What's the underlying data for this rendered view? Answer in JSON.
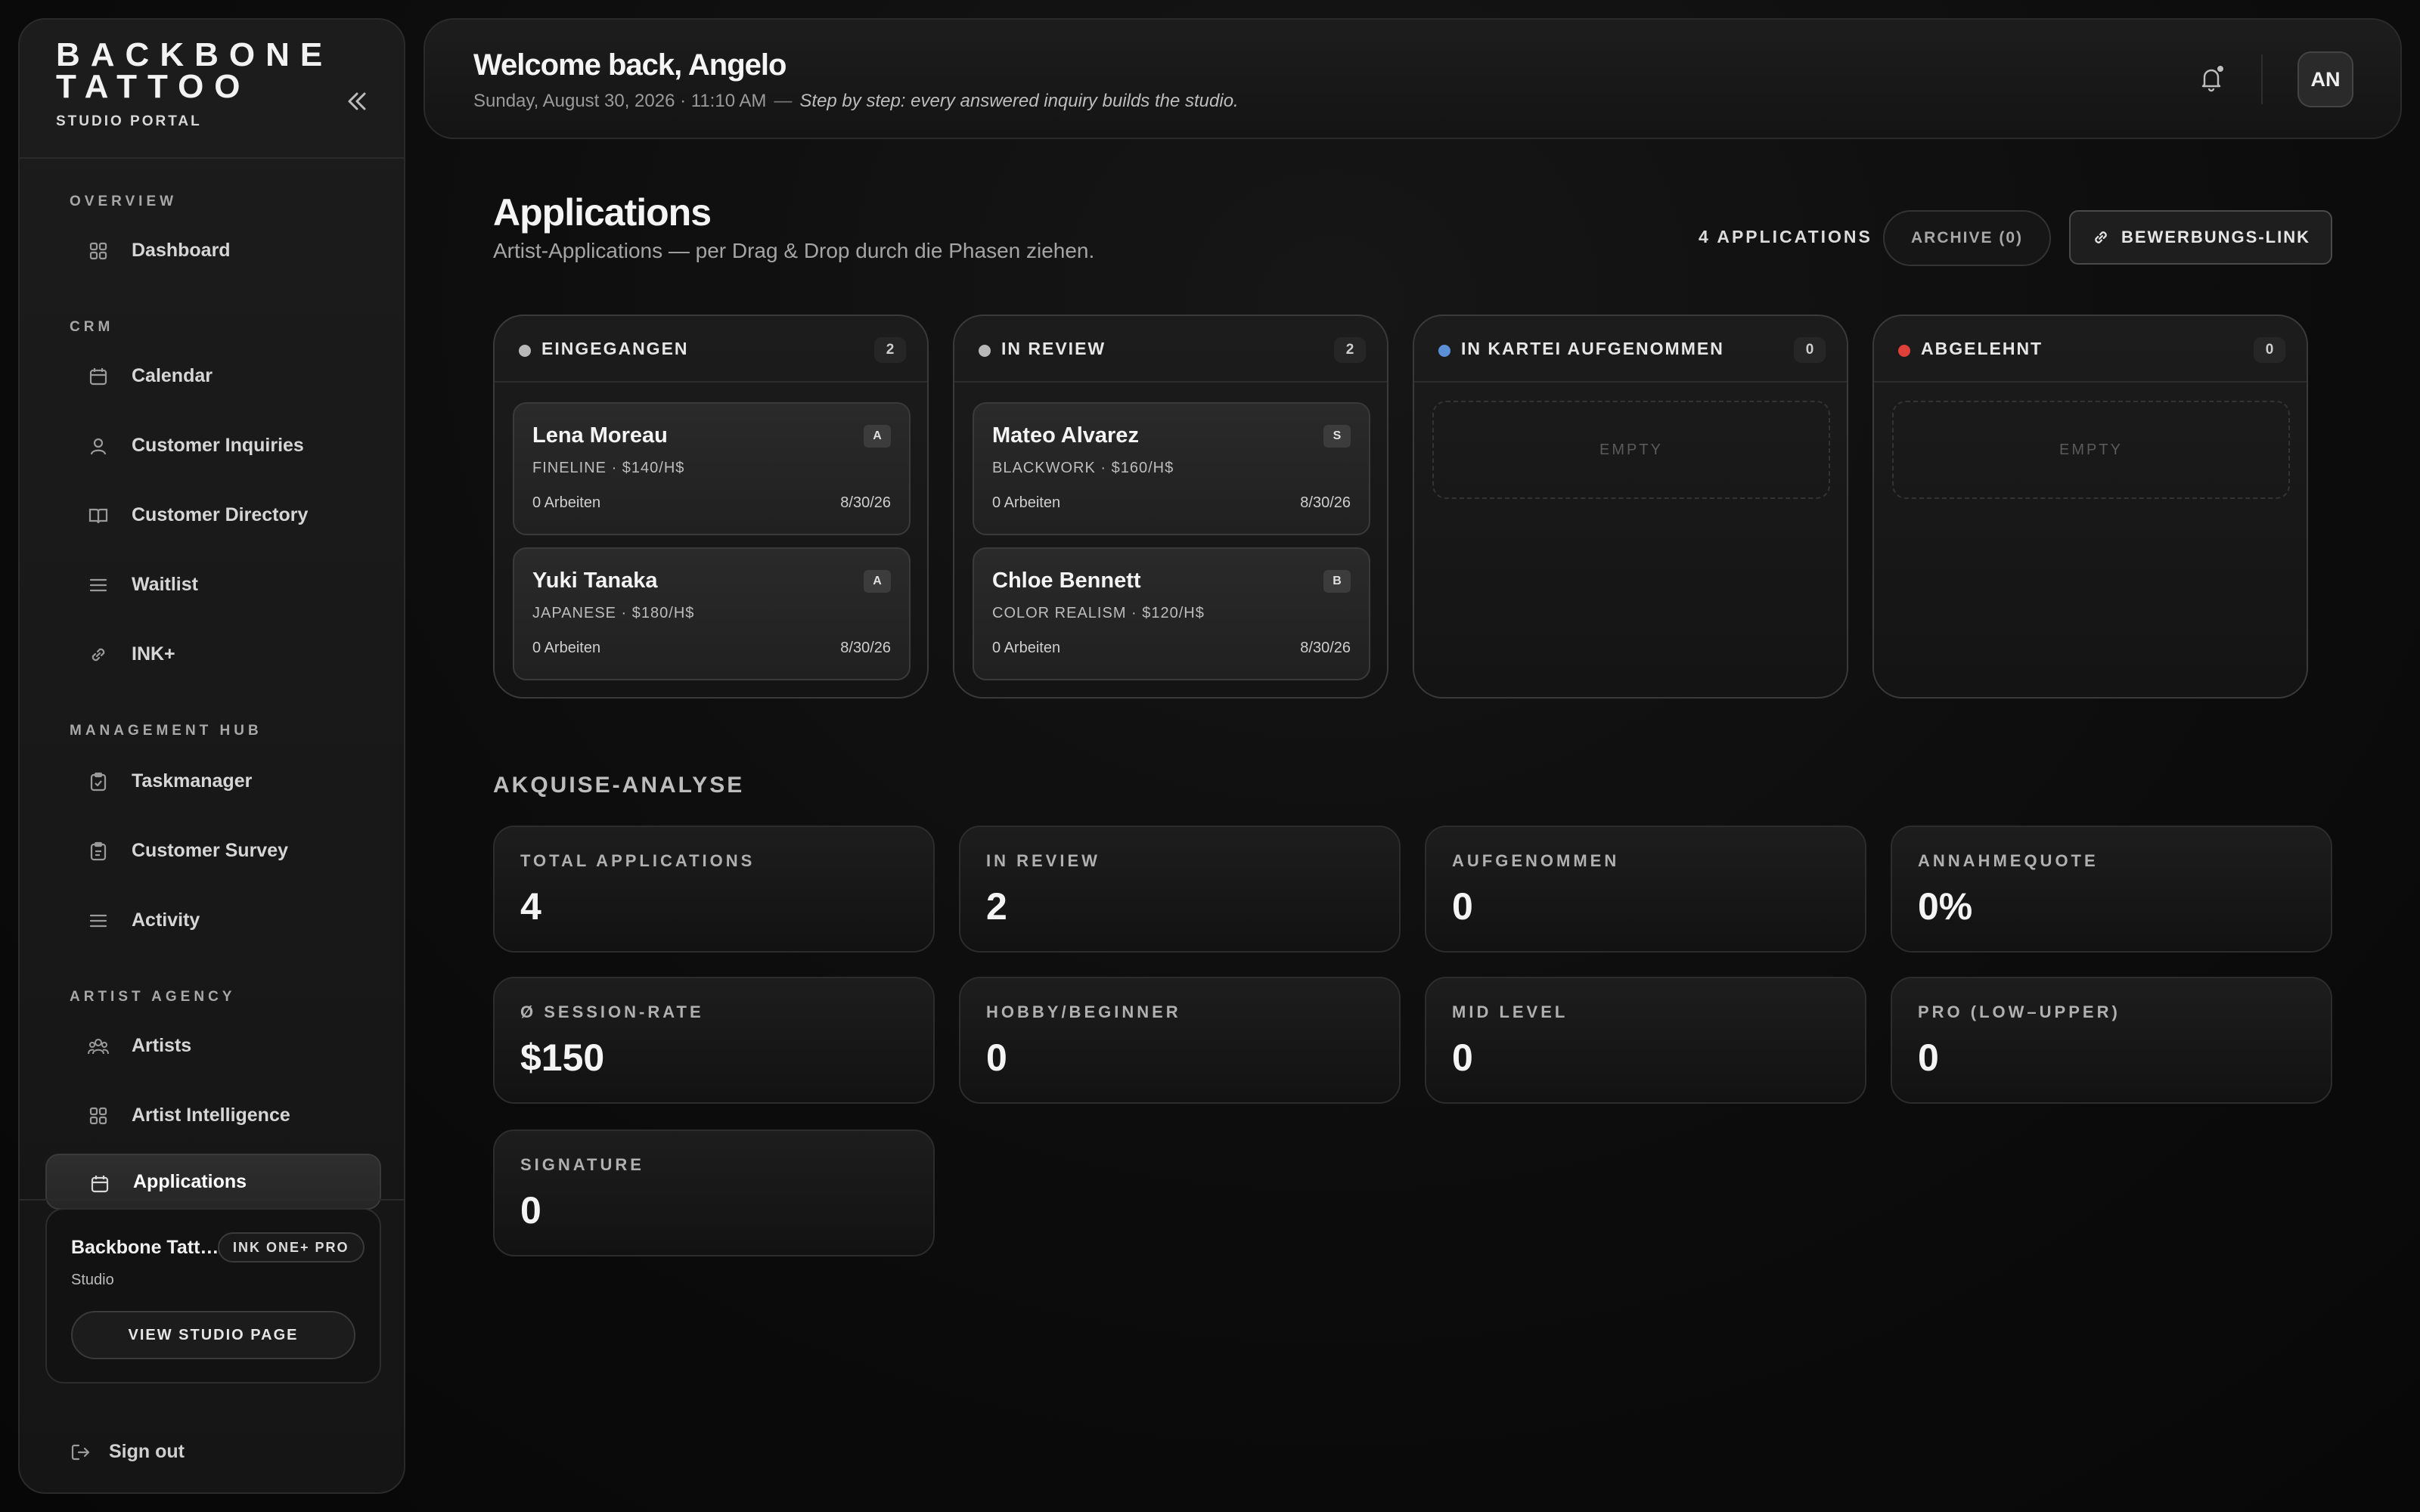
{
  "brand": {
    "line1": "BACKBONE",
    "line2": "TATTOO",
    "subtitle": "STUDIO PORTAL"
  },
  "sidebar": {
    "sections": [
      {
        "label": "OVERVIEW",
        "items": [
          {
            "label": "Dashboard",
            "icon": "grid-icon"
          }
        ]
      },
      {
        "label": "CRM",
        "items": [
          {
            "label": "Calendar",
            "icon": "calendar-icon"
          },
          {
            "label": "Customer Inquiries",
            "icon": "user-icon"
          },
          {
            "label": "Customer Directory",
            "icon": "book-icon"
          },
          {
            "label": "Waitlist",
            "icon": "list-icon"
          },
          {
            "label": "INK+",
            "icon": "link-icon"
          }
        ]
      },
      {
        "label": "MANAGEMENT HUB",
        "items": [
          {
            "label": "Taskmanager",
            "icon": "clipboard-check-icon"
          },
          {
            "label": "Customer Survey",
            "icon": "clipboard-icon"
          },
          {
            "label": "Activity",
            "icon": "list-icon"
          }
        ]
      },
      {
        "label": "ARTIST AGENCY",
        "items": [
          {
            "label": "Artists",
            "icon": "users-icon"
          },
          {
            "label": "Artist Intelligence",
            "icon": "grid-icon"
          },
          {
            "label": "Applications",
            "icon": "calendar-icon",
            "active": true
          }
        ]
      }
    ],
    "studio": {
      "name": "Backbone Tattoo Studio",
      "badge": "INK ONE+ PRO",
      "type": "Studio",
      "button": "VIEW STUDIO PAGE"
    },
    "signout": "Sign out"
  },
  "header": {
    "welcome": "Welcome back, Angelo",
    "datetime": "Sunday, August 30, 2026 · 11:10 AM",
    "separator": "—",
    "tagline": "Step by step: every answered inquiry builds the studio.",
    "avatar": "AN"
  },
  "page": {
    "title": "Applications",
    "subtitle": "Artist-Applications — per Drag & Drop durch die Phasen ziehen.",
    "count_label": "4 APPLICATIONS",
    "archive_button": "ARCHIVE (0)",
    "link_button": "BEWERBUNGS-LINK"
  },
  "columns": [
    {
      "title": "EINGEGANGEN",
      "count": "2",
      "dot_color": "#b8b8b8",
      "cards": [
        {
          "name": "Lena Moreau",
          "badge": "A",
          "meta": "FINELINE · $140/H$",
          "works": "0 Arbeiten",
          "date": "8/30/26"
        },
        {
          "name": "Yuki Tanaka",
          "badge": "A",
          "meta": "JAPANESE · $180/H$",
          "works": "0 Arbeiten",
          "date": "8/30/26"
        }
      ]
    },
    {
      "title": "IN REVIEW",
      "count": "2",
      "dot_color": "#b8b8b8",
      "cards": [
        {
          "name": "Mateo Alvarez",
          "badge": "S",
          "meta": "BLACKWORK · $160/H$",
          "works": "0 Arbeiten",
          "date": "8/30/26"
        },
        {
          "name": "Chloe Bennett",
          "badge": "B",
          "meta": "COLOR REALISM · $120/H$",
          "works": "0 Arbeiten",
          "date": "8/30/26"
        }
      ]
    },
    {
      "title": "IN KARTEI AUFGENOMMEN",
      "count": "0",
      "dot_color": "#5b8fd6",
      "empty": "EMPTY",
      "cards": []
    },
    {
      "title": "ABGELEHNT",
      "count": "0",
      "dot_color": "#e0403a",
      "empty": "EMPTY",
      "cards": []
    }
  ],
  "analytics": {
    "title": "AKQUISE-ANALYSE",
    "stats": [
      {
        "label": "TOTAL APPLICATIONS",
        "value": "4"
      },
      {
        "label": "IN REVIEW",
        "value": "2"
      },
      {
        "label": "AUFGENOMMEN",
        "value": "0"
      },
      {
        "label": "ANNAHMEQUOTE",
        "value": "0%"
      },
      {
        "label": "Ø SESSION-RATE",
        "value": "$150"
      },
      {
        "label": "HOBBY/BEGINNER",
        "value": "0"
      },
      {
        "label": "MID LEVEL",
        "value": "0"
      },
      {
        "label": "PRO (LOW–UPPER)",
        "value": "0"
      },
      {
        "label": "SIGNATURE",
        "value": "0"
      }
    ]
  }
}
